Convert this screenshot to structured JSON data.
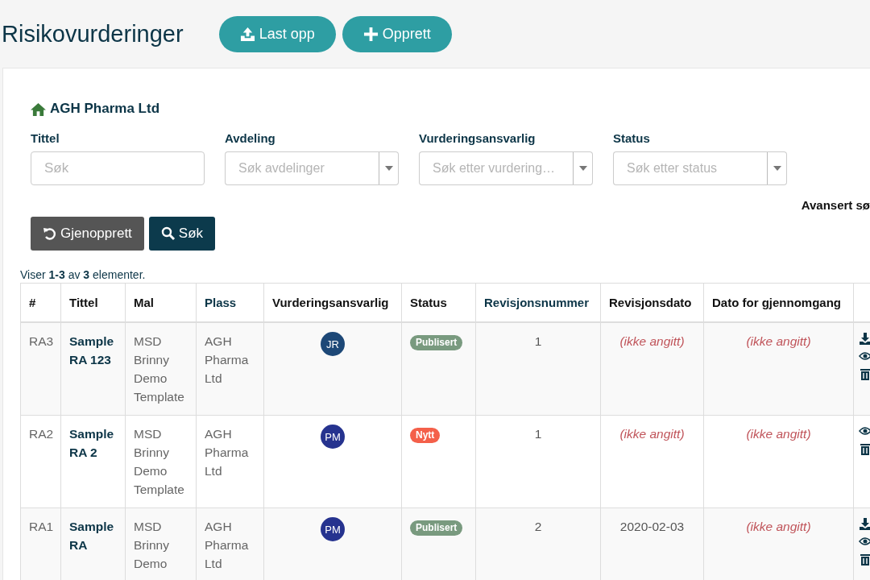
{
  "page_title": "Risikovurderinger",
  "header_buttons": [
    {
      "kind": "upload",
      "label": "Last opp"
    },
    {
      "kind": "create",
      "label": "Opprett"
    }
  ],
  "organization": "AGH Pharma Ltd",
  "filters": [
    {
      "label": "Tittel",
      "kind": "text",
      "placeholder": "Søk"
    },
    {
      "label": "Avdeling",
      "kind": "select",
      "placeholder": "Søk avdelinger"
    },
    {
      "label": "Vurderingsansvarlig",
      "kind": "select",
      "placeholder": "Søk etter vurdering…"
    },
    {
      "label": "Status",
      "kind": "select",
      "placeholder": "Søk etter status"
    }
  ],
  "advanced_search": "Avansert sø",
  "reset_button": "Gjenopprett",
  "search_button": "Søk",
  "summary": "Viser **1-3** av **3** elementer.",
  "table": {
    "columns": [
      {
        "label": "#",
        "sortable": false
      },
      {
        "label": "Tittel",
        "sortable": false
      },
      {
        "label": "Mal",
        "sortable": false
      },
      {
        "label": "Plass",
        "sortable": true
      },
      {
        "label": "Vurderingsansvarlig",
        "sortable": false
      },
      {
        "label": "Status",
        "sortable": false
      },
      {
        "label": "Revisjonsnummer",
        "sortable": true
      },
      {
        "label": "Revisjonsdato",
        "sortable": false
      },
      {
        "label": "Dato for gjennomgang",
        "sortable": false
      }
    ],
    "rows": [
      {
        "id": "RA3",
        "title": "Sample RA 123",
        "template": "MSD Brinny Demo Template",
        "place": "AGH Pharma Ltd",
        "assessor": {
          "initials": "JR",
          "color": "#1d4877"
        },
        "status": {
          "label": "Publisert",
          "color": "#799a7f"
        },
        "revision": "1",
        "revision_date": {
          "text": "(ikke angitt)",
          "missing": true
        },
        "review_date": {
          "text": "(ikke angitt)",
          "missing": true
        },
        "actions": [
          {
            "kind": "download"
          },
          {
            "kind": "view"
          },
          {
            "kind": "delete"
          }
        ]
      },
      {
        "id": "RA2",
        "title": "Sample RA 2",
        "template": "MSD Brinny Demo Template",
        "place": "AGH Pharma Ltd",
        "assessor": {
          "initials": "PM",
          "color": "#26338f"
        },
        "status": {
          "label": "Nytt",
          "color": "#f4604a"
        },
        "revision": "1",
        "revision_date": {
          "text": "(ikke angitt)",
          "missing": true
        },
        "review_date": {
          "text": "(ikke angitt)",
          "missing": true
        },
        "actions": [
          {
            "kind": "view"
          },
          {
            "kind": "delete"
          }
        ]
      },
      {
        "id": "RA1",
        "title": "Sample RA",
        "template": "MSD Brinny Demo",
        "place": "AGH Pharma Ltd",
        "assessor": {
          "initials": "PM",
          "color": "#26338f"
        },
        "status": {
          "label": "Publisert",
          "color": "#799a7f"
        },
        "revision": "2",
        "revision_date": {
          "text": "2020-02-03",
          "missing": false
        },
        "review_date": {
          "text": "(ikke angitt)",
          "missing": true
        },
        "actions": [
          {
            "kind": "download"
          },
          {
            "kind": "view"
          },
          {
            "kind": "delete"
          }
        ]
      }
    ]
  }
}
